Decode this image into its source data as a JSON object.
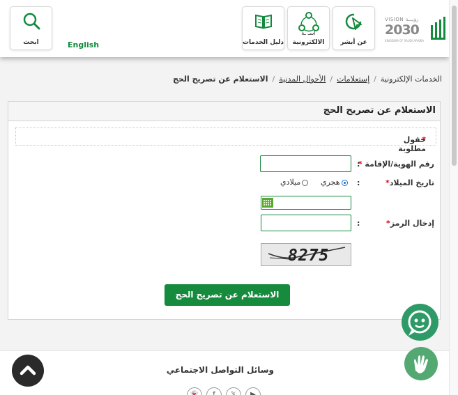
{
  "header": {
    "search_label": "ابحث",
    "language_link": "English",
    "services_guide_label": "دليل الخدمات",
    "eservices_label": "الالكترونية",
    "eservices_top_label": "اسـ ـة",
    "about_absher_label": "عن أبشر",
    "vision_top": "VISION رؤيـــة",
    "vision_year": "2030",
    "vision_sub": "KINGDOM OF SAUDI ARABIA",
    "colors": {
      "brand_green": "#138a3e",
      "button_green": "#168a3d"
    }
  },
  "breadcrumb": {
    "items": [
      "الخدمات الإلكترونية",
      "إستعلامات",
      "الأحوال المدنية"
    ],
    "current": "الاستعلام عن تصريح الحج",
    "separator": "/"
  },
  "panel": {
    "title": "الاستعلام عن تصريح الحج",
    "required_note": "حقول مطلوبة",
    "required_star": "*",
    "id_label": "رقم الهوية/الإقامة",
    "birth_label": "تاريخ الميلاد",
    "captcha_label": "إدخال الرمز",
    "colon": ":",
    "radio_hijri": "هجري",
    "radio_gregorian": "ميلادي",
    "id_value": "",
    "birth_value": "",
    "captcha_value": "",
    "captcha_text": "8275",
    "submit_label": "الاستعلام عن تصريح الحج"
  },
  "footer": {
    "social_title": "وسائل التواصل الاجتماعي",
    "social_icons": [
      "snapchat-icon",
      "facebook-icon",
      "x-icon",
      "youtube-icon"
    ]
  }
}
